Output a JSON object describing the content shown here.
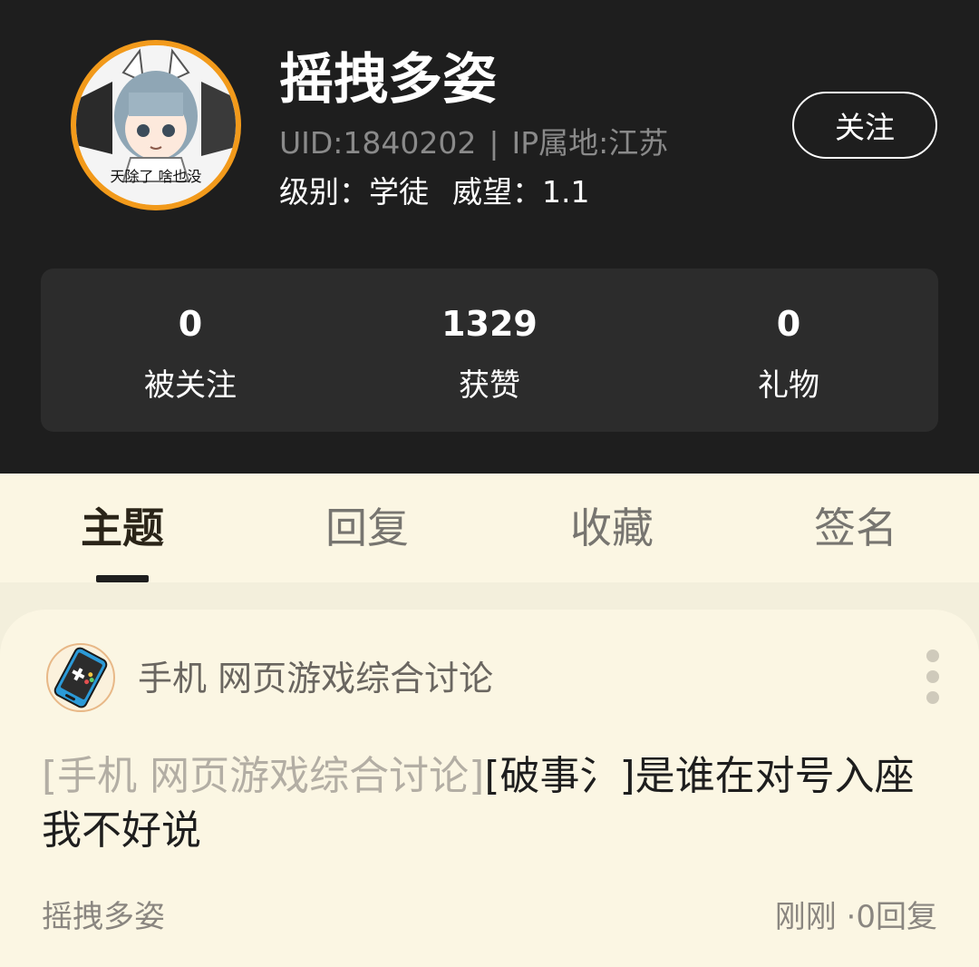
{
  "profile": {
    "username": "摇拽多姿",
    "uid_text": "UID:1840202",
    "separator": "|",
    "ip_text": "IP属地:江苏",
    "level_text": "级别：学徒",
    "prestige_text": "威望：1.1",
    "follow_label": "关注",
    "avatar_caption": "天除了 啥也没"
  },
  "stats": [
    {
      "value": "0",
      "label": "被关注"
    },
    {
      "value": "1329",
      "label": "获赞"
    },
    {
      "value": "0",
      "label": "礼物"
    }
  ],
  "tabs": [
    {
      "label": "主题",
      "active": true
    },
    {
      "label": "回复",
      "active": false
    },
    {
      "label": "收藏",
      "active": false
    },
    {
      "label": "签名",
      "active": false
    }
  ],
  "post": {
    "forum_name": "手机 网页游戏综合讨论",
    "forum_icon": "gamepad-phone-icon",
    "title_prefix": "[手机 网页游戏综合讨论]",
    "title_rest": "[破事氵]是谁在对号入座我不好说",
    "author": "摇拽多姿",
    "time_text": "刚刚",
    "meta_separator": "·",
    "reply_text": "0回复"
  },
  "colors": {
    "header_bg": "#1e1e1e",
    "avatar_ring": "#f29a1b",
    "content_bg": "#fbf6e3"
  }
}
